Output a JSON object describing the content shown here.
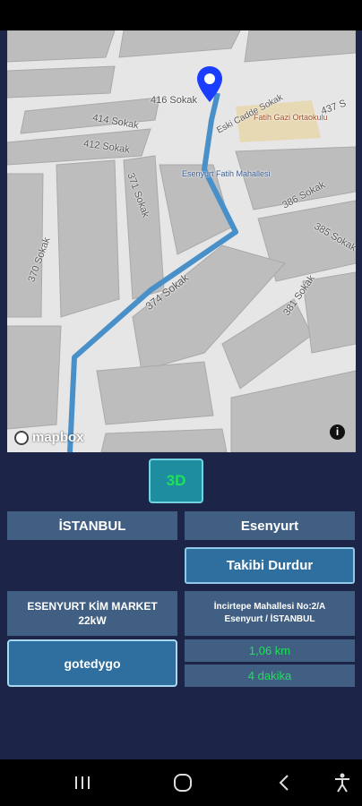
{
  "map": {
    "streets": [
      "416 Sokak",
      "414 Sokak",
      "412 Sokak",
      "371 Sokak",
      "370 Sokak",
      "374 Sokak",
      "381 Sokak",
      "385 Sokak",
      "386 Sokak",
      "437 S",
      "Eski Cadde Sokak",
      "Esenyurt Fatih Mahallesi"
    ],
    "pois": [
      "Fatih Gazi Ortaokulu",
      "Esenyurt Fatih Mahallesi"
    ],
    "attribution": "mapbox",
    "info_label": "i"
  },
  "toggle_3d": {
    "label": "3D",
    "color": "#1fe05a"
  },
  "city": "İSTANBUL",
  "district": "Esenyurt",
  "stop_tracking_label": "Takibi Durdur",
  "station": {
    "name": "ESENYURT KİM MARKET",
    "power": "22kW"
  },
  "address": {
    "line1": "İncirtepe Mahallesi No:2/A",
    "line2": "Esenyurt / İSTANBUL"
  },
  "go_button_label": "gotedygo",
  "distance": "1,06 km",
  "duration": "4 dakika",
  "colors": {
    "accent_green": "#1fe05a",
    "route": "#4a90c8",
    "panel": "#415f82",
    "background": "#1c2448"
  },
  "nav_icons": [
    "recent-apps-icon",
    "home-icon",
    "back-icon",
    "accessibility-icon"
  ]
}
